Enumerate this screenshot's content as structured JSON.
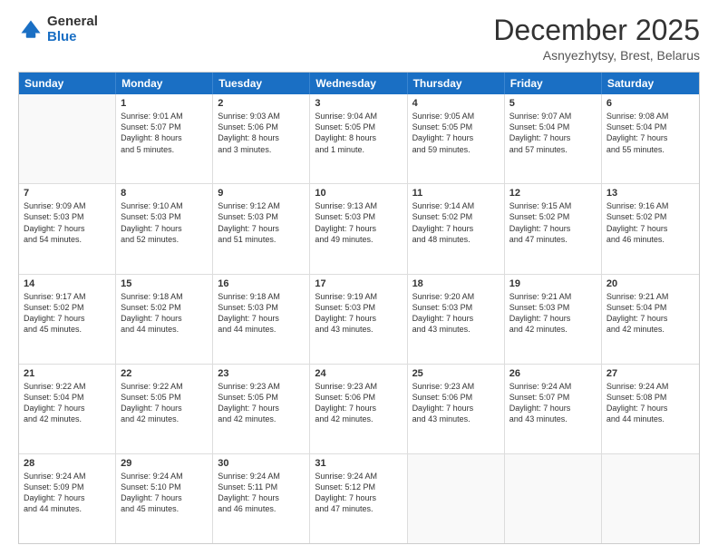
{
  "header": {
    "logo_general": "General",
    "logo_blue": "Blue",
    "month_title": "December 2025",
    "location": "Asnyezhytsy, Brest, Belarus"
  },
  "days_of_week": [
    "Sunday",
    "Monday",
    "Tuesday",
    "Wednesday",
    "Thursday",
    "Friday",
    "Saturday"
  ],
  "rows": [
    [
      {
        "day": "",
        "empty": true
      },
      {
        "day": "1",
        "sunrise": "Sunrise: 9:01 AM",
        "sunset": "Sunset: 5:07 PM",
        "daylight": "Daylight: 8 hours",
        "daylight2": "and 5 minutes."
      },
      {
        "day": "2",
        "sunrise": "Sunrise: 9:03 AM",
        "sunset": "Sunset: 5:06 PM",
        "daylight": "Daylight: 8 hours",
        "daylight2": "and 3 minutes."
      },
      {
        "day": "3",
        "sunrise": "Sunrise: 9:04 AM",
        "sunset": "Sunset: 5:05 PM",
        "daylight": "Daylight: 8 hours",
        "daylight2": "and 1 minute."
      },
      {
        "day": "4",
        "sunrise": "Sunrise: 9:05 AM",
        "sunset": "Sunset: 5:05 PM",
        "daylight": "Daylight: 7 hours",
        "daylight2": "and 59 minutes."
      },
      {
        "day": "5",
        "sunrise": "Sunrise: 9:07 AM",
        "sunset": "Sunset: 5:04 PM",
        "daylight": "Daylight: 7 hours",
        "daylight2": "and 57 minutes."
      },
      {
        "day": "6",
        "sunrise": "Sunrise: 9:08 AM",
        "sunset": "Sunset: 5:04 PM",
        "daylight": "Daylight: 7 hours",
        "daylight2": "and 55 minutes."
      }
    ],
    [
      {
        "day": "7",
        "sunrise": "Sunrise: 9:09 AM",
        "sunset": "Sunset: 5:03 PM",
        "daylight": "Daylight: 7 hours",
        "daylight2": "and 54 minutes."
      },
      {
        "day": "8",
        "sunrise": "Sunrise: 9:10 AM",
        "sunset": "Sunset: 5:03 PM",
        "daylight": "Daylight: 7 hours",
        "daylight2": "and 52 minutes."
      },
      {
        "day": "9",
        "sunrise": "Sunrise: 9:12 AM",
        "sunset": "Sunset: 5:03 PM",
        "daylight": "Daylight: 7 hours",
        "daylight2": "and 51 minutes."
      },
      {
        "day": "10",
        "sunrise": "Sunrise: 9:13 AM",
        "sunset": "Sunset: 5:03 PM",
        "daylight": "Daylight: 7 hours",
        "daylight2": "and 49 minutes."
      },
      {
        "day": "11",
        "sunrise": "Sunrise: 9:14 AM",
        "sunset": "Sunset: 5:02 PM",
        "daylight": "Daylight: 7 hours",
        "daylight2": "and 48 minutes."
      },
      {
        "day": "12",
        "sunrise": "Sunrise: 9:15 AM",
        "sunset": "Sunset: 5:02 PM",
        "daylight": "Daylight: 7 hours",
        "daylight2": "and 47 minutes."
      },
      {
        "day": "13",
        "sunrise": "Sunrise: 9:16 AM",
        "sunset": "Sunset: 5:02 PM",
        "daylight": "Daylight: 7 hours",
        "daylight2": "and 46 minutes."
      }
    ],
    [
      {
        "day": "14",
        "sunrise": "Sunrise: 9:17 AM",
        "sunset": "Sunset: 5:02 PM",
        "daylight": "Daylight: 7 hours",
        "daylight2": "and 45 minutes."
      },
      {
        "day": "15",
        "sunrise": "Sunrise: 9:18 AM",
        "sunset": "Sunset: 5:02 PM",
        "daylight": "Daylight: 7 hours",
        "daylight2": "and 44 minutes."
      },
      {
        "day": "16",
        "sunrise": "Sunrise: 9:18 AM",
        "sunset": "Sunset: 5:03 PM",
        "daylight": "Daylight: 7 hours",
        "daylight2": "and 44 minutes."
      },
      {
        "day": "17",
        "sunrise": "Sunrise: 9:19 AM",
        "sunset": "Sunset: 5:03 PM",
        "daylight": "Daylight: 7 hours",
        "daylight2": "and 43 minutes."
      },
      {
        "day": "18",
        "sunrise": "Sunrise: 9:20 AM",
        "sunset": "Sunset: 5:03 PM",
        "daylight": "Daylight: 7 hours",
        "daylight2": "and 43 minutes."
      },
      {
        "day": "19",
        "sunrise": "Sunrise: 9:21 AM",
        "sunset": "Sunset: 5:03 PM",
        "daylight": "Daylight: 7 hours",
        "daylight2": "and 42 minutes."
      },
      {
        "day": "20",
        "sunrise": "Sunrise: 9:21 AM",
        "sunset": "Sunset: 5:04 PM",
        "daylight": "Daylight: 7 hours",
        "daylight2": "and 42 minutes."
      }
    ],
    [
      {
        "day": "21",
        "sunrise": "Sunrise: 9:22 AM",
        "sunset": "Sunset: 5:04 PM",
        "daylight": "Daylight: 7 hours",
        "daylight2": "and 42 minutes."
      },
      {
        "day": "22",
        "sunrise": "Sunrise: 9:22 AM",
        "sunset": "Sunset: 5:05 PM",
        "daylight": "Daylight: 7 hours",
        "daylight2": "and 42 minutes."
      },
      {
        "day": "23",
        "sunrise": "Sunrise: 9:23 AM",
        "sunset": "Sunset: 5:05 PM",
        "daylight": "Daylight: 7 hours",
        "daylight2": "and 42 minutes."
      },
      {
        "day": "24",
        "sunrise": "Sunrise: 9:23 AM",
        "sunset": "Sunset: 5:06 PM",
        "daylight": "Daylight: 7 hours",
        "daylight2": "and 42 minutes."
      },
      {
        "day": "25",
        "sunrise": "Sunrise: 9:23 AM",
        "sunset": "Sunset: 5:06 PM",
        "daylight": "Daylight: 7 hours",
        "daylight2": "and 43 minutes."
      },
      {
        "day": "26",
        "sunrise": "Sunrise: 9:24 AM",
        "sunset": "Sunset: 5:07 PM",
        "daylight": "Daylight: 7 hours",
        "daylight2": "and 43 minutes."
      },
      {
        "day": "27",
        "sunrise": "Sunrise: 9:24 AM",
        "sunset": "Sunset: 5:08 PM",
        "daylight": "Daylight: 7 hours",
        "daylight2": "and 44 minutes."
      }
    ],
    [
      {
        "day": "28",
        "sunrise": "Sunrise: 9:24 AM",
        "sunset": "Sunset: 5:09 PM",
        "daylight": "Daylight: 7 hours",
        "daylight2": "and 44 minutes."
      },
      {
        "day": "29",
        "sunrise": "Sunrise: 9:24 AM",
        "sunset": "Sunset: 5:10 PM",
        "daylight": "Daylight: 7 hours",
        "daylight2": "and 45 minutes."
      },
      {
        "day": "30",
        "sunrise": "Sunrise: 9:24 AM",
        "sunset": "Sunset: 5:11 PM",
        "daylight": "Daylight: 7 hours",
        "daylight2": "and 46 minutes."
      },
      {
        "day": "31",
        "sunrise": "Sunrise: 9:24 AM",
        "sunset": "Sunset: 5:12 PM",
        "daylight": "Daylight: 7 hours",
        "daylight2": "and 47 minutes."
      },
      {
        "day": "",
        "empty": true
      },
      {
        "day": "",
        "empty": true
      },
      {
        "day": "",
        "empty": true
      }
    ]
  ]
}
